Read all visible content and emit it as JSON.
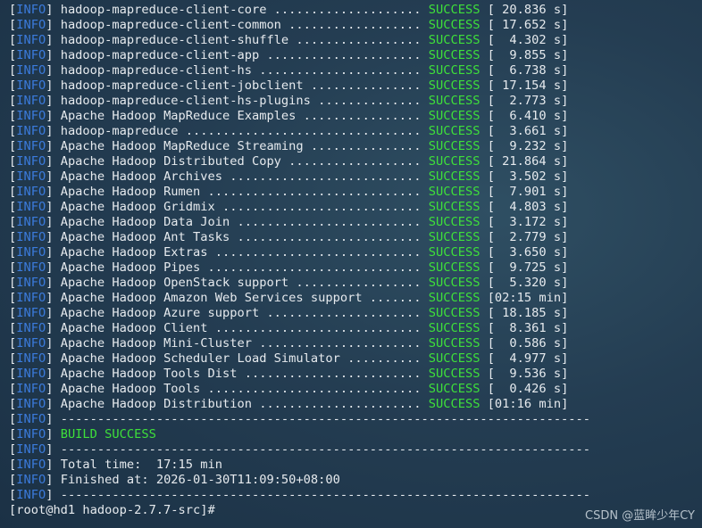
{
  "terminal": {
    "log_tag": "INFO",
    "module_lines": [
      {
        "text": "hadoop-mapreduce-client-core ....................",
        "status": "SUCCESS",
        "time": "[ 20.836 s]"
      },
      {
        "text": "hadoop-mapreduce-client-common ..................",
        "status": "SUCCESS",
        "time": "[ 17.652 s]"
      },
      {
        "text": "hadoop-mapreduce-client-shuffle .................",
        "status": "SUCCESS",
        "time": "[  4.302 s]"
      },
      {
        "text": "hadoop-mapreduce-client-app .....................",
        "status": "SUCCESS",
        "time": "[  9.855 s]"
      },
      {
        "text": "hadoop-mapreduce-client-hs ......................",
        "status": "SUCCESS",
        "time": "[  6.738 s]"
      },
      {
        "text": "hadoop-mapreduce-client-jobclient ...............",
        "status": "SUCCESS",
        "time": "[ 17.154 s]"
      },
      {
        "text": "hadoop-mapreduce-client-hs-plugins ..............",
        "status": "SUCCESS",
        "time": "[  2.773 s]"
      },
      {
        "text": "Apache Hadoop MapReduce Examples ................",
        "status": "SUCCESS",
        "time": "[  6.410 s]"
      },
      {
        "text": "hadoop-mapreduce ................................",
        "status": "SUCCESS",
        "time": "[  3.661 s]"
      },
      {
        "text": "Apache Hadoop MapReduce Streaming ...............",
        "status": "SUCCESS",
        "time": "[  9.232 s]"
      },
      {
        "text": "Apache Hadoop Distributed Copy ..................",
        "status": "SUCCESS",
        "time": "[ 21.864 s]"
      },
      {
        "text": "Apache Hadoop Archives ..........................",
        "status": "SUCCESS",
        "time": "[  3.502 s]"
      },
      {
        "text": "Apache Hadoop Rumen .............................",
        "status": "SUCCESS",
        "time": "[  7.901 s]"
      },
      {
        "text": "Apache Hadoop Gridmix ...........................",
        "status": "SUCCESS",
        "time": "[  4.803 s]"
      },
      {
        "text": "Apache Hadoop Data Join .........................",
        "status": "SUCCESS",
        "time": "[  3.172 s]"
      },
      {
        "text": "Apache Hadoop Ant Tasks .........................",
        "status": "SUCCESS",
        "time": "[  2.779 s]"
      },
      {
        "text": "Apache Hadoop Extras ............................",
        "status": "SUCCESS",
        "time": "[  3.650 s]"
      },
      {
        "text": "Apache Hadoop Pipes .............................",
        "status": "SUCCESS",
        "time": "[  9.725 s]"
      },
      {
        "text": "Apache Hadoop OpenStack support .................",
        "status": "SUCCESS",
        "time": "[  5.320 s]"
      },
      {
        "text": "Apache Hadoop Amazon Web Services support .......",
        "status": "SUCCESS",
        "time": "[02:15 min]"
      },
      {
        "text": "Apache Hadoop Azure support .....................",
        "status": "SUCCESS",
        "time": "[ 18.185 s]"
      },
      {
        "text": "Apache Hadoop Client ............................",
        "status": "SUCCESS",
        "time": "[  8.361 s]"
      },
      {
        "text": "Apache Hadoop Mini-Cluster ......................",
        "status": "SUCCESS",
        "time": "[  0.586 s]"
      },
      {
        "text": "Apache Hadoop Scheduler Load Simulator ..........",
        "status": "SUCCESS",
        "time": "[  4.977 s]"
      },
      {
        "text": "Apache Hadoop Tools Dist ........................",
        "status": "SUCCESS",
        "time": "[  9.536 s]"
      },
      {
        "text": "Apache Hadoop Tools .............................",
        "status": "SUCCESS",
        "time": "[  0.426 s]"
      },
      {
        "text": "Apache Hadoop Distribution ......................",
        "status": "SUCCESS",
        "time": "[01:16 min]"
      }
    ],
    "separator": "------------------------------------------------------------------------",
    "build_result": "BUILD SUCCESS",
    "total_time": "Total time:  17:15 min",
    "finished_at": "Finished at: 2026-01-30T11:09:50+08:00",
    "prompt": "[root@hd1 hadoop-2.7.7-src]#"
  },
  "watermark": "CSDN @蓝眸少年CY",
  "colors": {
    "info_tag": "#3b7bdc",
    "success": "#3ee03a",
    "text": "#e6eaee",
    "background": "#243d52"
  }
}
